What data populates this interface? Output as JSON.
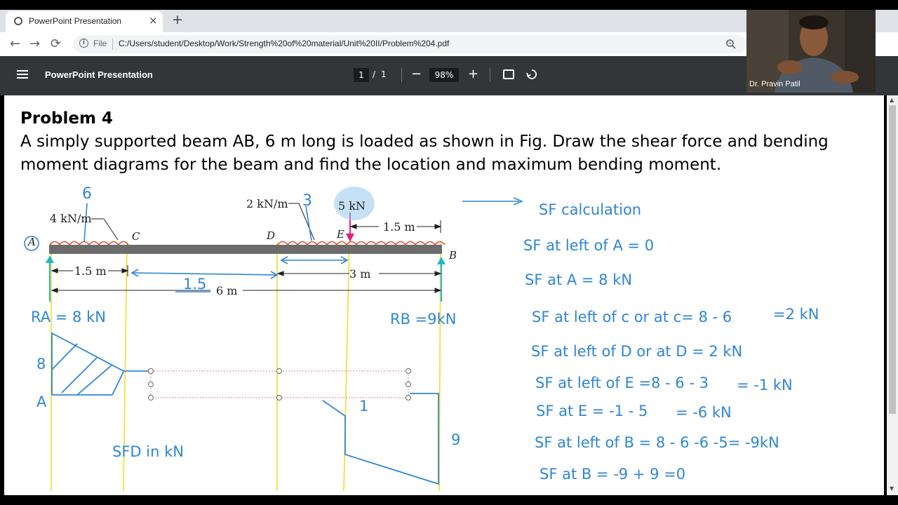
{
  "browser": {
    "tab_title": "PowerPoint Presentation",
    "tab_close": "×",
    "new_tab": "+",
    "back": "←",
    "forward": "→",
    "reload": "⟳",
    "info_glyph": "i",
    "file_label": "File",
    "url": "C:/Users/student/Desktop/Work/Strength%20of%20material/Unit%20II/Problem%204.pdf"
  },
  "pdf_toolbar": {
    "title": "PowerPoint Presentation",
    "page_current": "1",
    "page_separator": "/",
    "page_total": "1",
    "zoom_out": "−",
    "zoom_level": "98%",
    "zoom_in": "+"
  },
  "webcam": {
    "presenter_name": "Dr. Pravin Patil"
  },
  "document": {
    "problem_title": "Problem 4",
    "problem_line1": "A simply supported beam AB, 6 m long is loaded as shown in Fig. Draw the shear force and bending",
    "problem_line2": "moment diagrams for the beam and find the location and  maximum bending moment."
  },
  "figure": {
    "label_udl1": "4 kN/m",
    "label_udl2": "2 kN/m",
    "label_point": "5 kN",
    "label_A": "A",
    "label_B": "B",
    "label_C": "C",
    "label_D": "D",
    "label_E": "E",
    "dim_AC": "1.5 m",
    "dim_EB": "1.5 m",
    "dim_DB": "3 m",
    "dim_total": "6 m"
  },
  "annotations": {
    "load1_total": "6",
    "load2_total": "3",
    "gap_CD": "1.5",
    "RA": "RA = 8 kN",
    "RB": "RB =9kN",
    "sfd_8": "8",
    "sfd_A": "A",
    "sfd_1": "1",
    "sfd_9": "9",
    "sfd_label": "SFD in kN"
  },
  "sf_calculation": {
    "heading": "SF calculation",
    "line1": "SF at left of A = 0",
    "line2": "SF at A = 8 kN",
    "line3": "SF at left of c or at c= 8 -  6",
    "line3_result": "=2 kN",
    "line4": "SF at left of D or at D = 2 kN",
    "line5": "SF at left of E =8 - 6 - 3",
    "line5_result": "= -1 kN",
    "line6": "SF at E = -1 -  5",
    "line6_result": "= -6 kN",
    "line7": "SF at left of B = 8 - 6 -6 -5= -9kN",
    "line8": "SF at B = -9 + 9 =0"
  },
  "colors": {
    "annotation_blue": "#2f86d6",
    "load_red": "#e0503a",
    "guide_yellow": "#f2dc2a",
    "arrow_magenta": "#e0217a",
    "support_cyan": "#20b8c8",
    "beam_gray": "#6b6b6b"
  }
}
